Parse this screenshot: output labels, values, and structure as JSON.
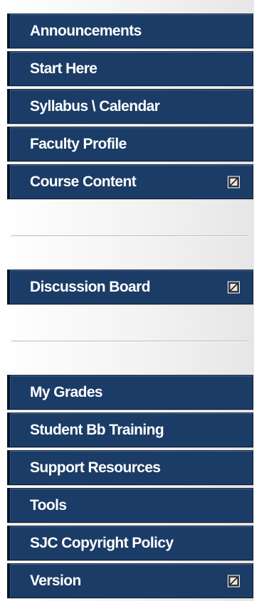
{
  "menu": {
    "groups": [
      {
        "items": [
          {
            "label": "Announcements",
            "hidden_icon": false
          },
          {
            "label": "Start Here",
            "hidden_icon": false
          },
          {
            "label": "Syllabus \\ Calendar",
            "hidden_icon": false
          },
          {
            "label": "Faculty Profile",
            "hidden_icon": false
          },
          {
            "label": "Course Content",
            "hidden_icon": true
          }
        ]
      },
      {
        "items": [
          {
            "label": "Discussion Board",
            "hidden_icon": true
          }
        ]
      },
      {
        "items": [
          {
            "label": "My Grades",
            "hidden_icon": false
          },
          {
            "label": "Student Bb Training",
            "hidden_icon": false
          },
          {
            "label": "Support Resources",
            "hidden_icon": false
          },
          {
            "label": "Tools",
            "hidden_icon": false
          },
          {
            "label": "SJC Copyright Policy",
            "hidden_icon": false
          },
          {
            "label": "Version",
            "hidden_icon": true
          }
        ]
      }
    ],
    "icons": {
      "hidden_indicator": "visibility-off-icon"
    },
    "colors": {
      "item_background": "#1b3c66",
      "item_text": "#ffffff"
    }
  }
}
